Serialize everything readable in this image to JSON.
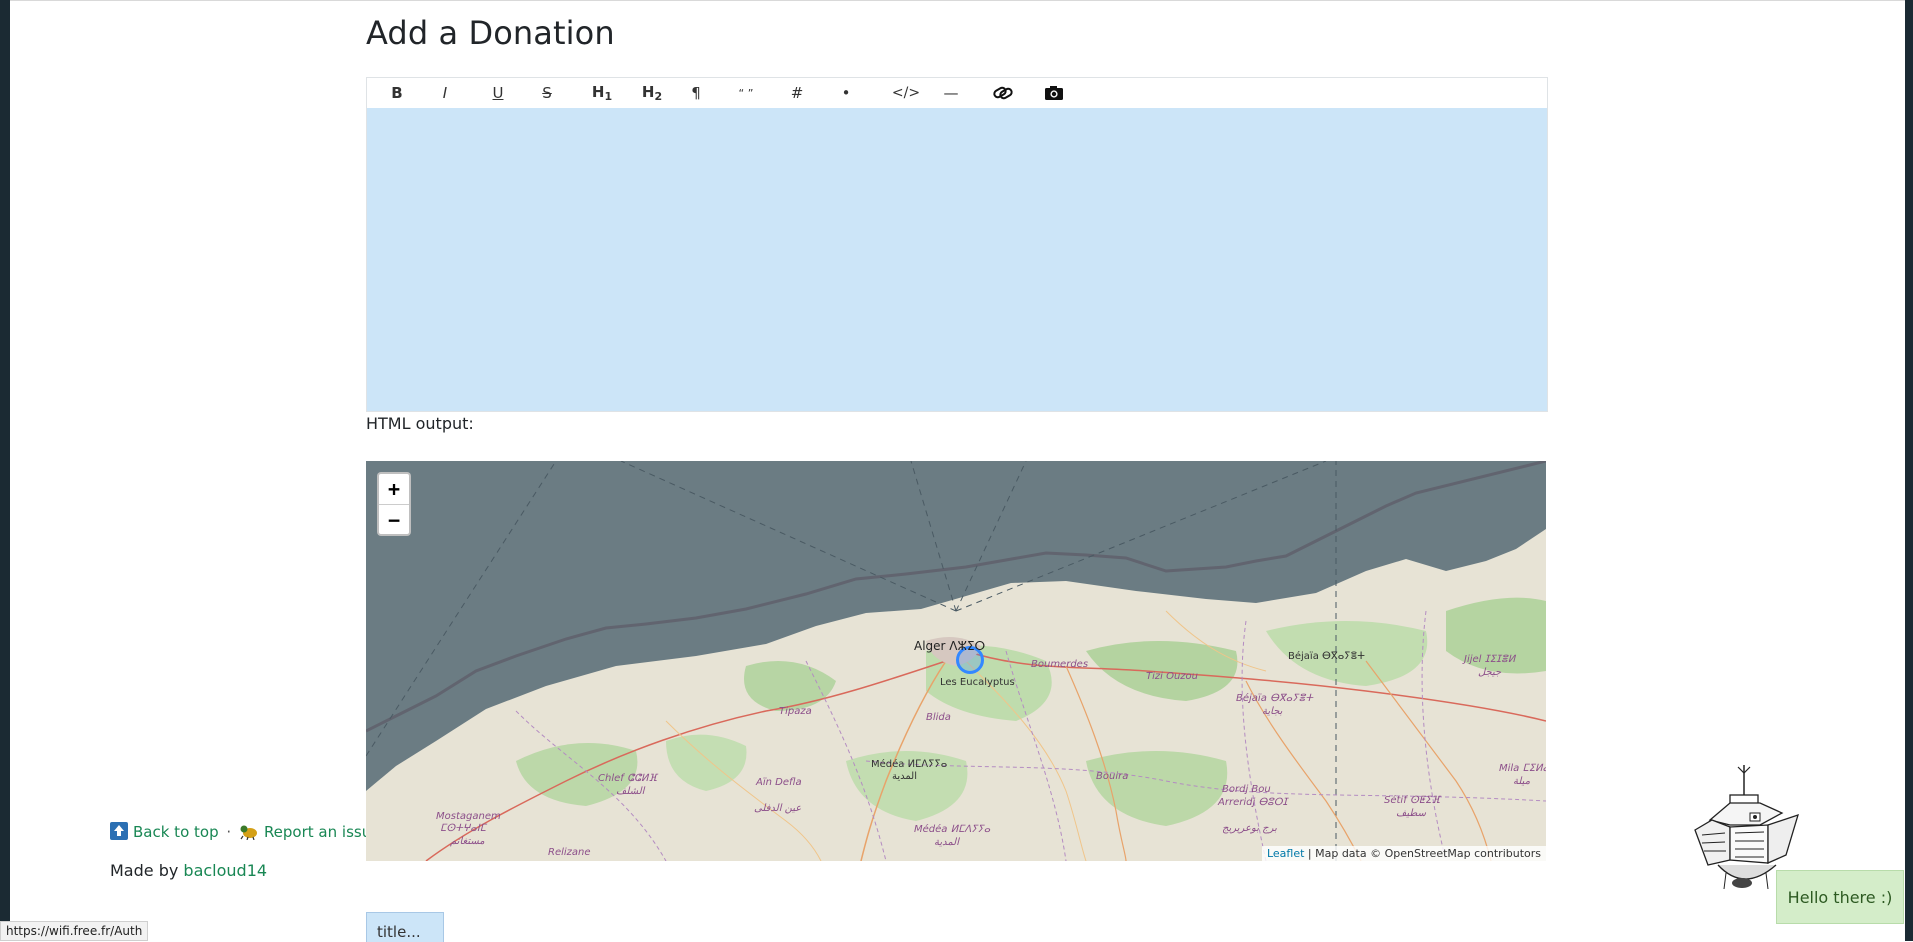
{
  "page": {
    "title": "Add a Donation"
  },
  "editor": {
    "toolbar": [
      {
        "name": "bold-button",
        "label": "B",
        "icon": "bold-icon"
      },
      {
        "name": "italic-button",
        "label": "I",
        "icon": "italic-icon"
      },
      {
        "name": "underline-button",
        "label": "U",
        "icon": "underline-icon"
      },
      {
        "name": "strikethrough-button",
        "label": "S",
        "icon": "strikethrough-icon"
      },
      {
        "name": "heading1-button",
        "label": "H",
        "sub": "1",
        "icon": "heading1-icon"
      },
      {
        "name": "heading2-button",
        "label": "H",
        "sub": "2",
        "icon": "heading2-icon"
      },
      {
        "name": "paragraph-button",
        "label": "¶",
        "icon": "paragraph-icon"
      },
      {
        "name": "quote-button",
        "label": "“ ”",
        "icon": "quote-icon"
      },
      {
        "name": "ordered-list-button",
        "label": "#",
        "icon": "ordered-list-icon"
      },
      {
        "name": "bullet-list-button",
        "label": "•",
        "icon": "bullet-list-icon"
      },
      {
        "name": "code-button",
        "label": "</>",
        "icon": "code-icon"
      },
      {
        "name": "horizontal-rule-button",
        "label": "—",
        "icon": "horizontal-rule-icon"
      },
      {
        "name": "link-button",
        "label": "",
        "icon": "link-icon"
      },
      {
        "name": "image-button",
        "label": "",
        "icon": "camera-icon"
      }
    ],
    "html_output_label": "HTML output:"
  },
  "map": {
    "zoom_in": "+",
    "zoom_out": "−",
    "labels": {
      "alger": "Alger ⴷⵣⵉⵔ",
      "les_eucalyptus": "Les Eucalyptus",
      "boumerdes": "Boumerdes",
      "tizi_ouzou": "Tizi Ouzou",
      "bejaia1": "Béjaïa ⴱⴳⴰⵢⴻⵜ",
      "bejaia2": "Béjaïa ⴱⴳⴰⵢⴻⵜ",
      "bejaia2_ar": "بجاية",
      "jijel": "Jijel ⵊⵉⵊⴻⵍ",
      "jijel_ar": "جيجل",
      "tipaza": "Tipaza",
      "blida": "Blida",
      "medea1": "Médéa ⵍⵎⴷⵢⵢⴰ",
      "medea1_ar": "المدية",
      "medea2": "Médéa ⵍⵎⴷⵢⵢⴰ",
      "medea2_ar": "المدية",
      "chlef": "Chlef ⵛⵛⵍⴼ",
      "chlef_ar": "الشلف",
      "ain_defla": "Aïn Defla",
      "ain_defla_ar": "عين الدفلى",
      "bouira": "Bouira",
      "bordj": "Bordj Bou",
      "arreridj": "Arreridj ⴱⵓⵔⵊ",
      "arreridj_ar": "برج بوعريريج",
      "setif": "Sétif ⵙⵟⵉⴼ",
      "setif_ar": "سطيف",
      "mila": "Mila ⵎⵉⵍⴰ",
      "mila_ar": "ميلة",
      "mostaganem": "Mostaganem",
      "mostaganem2": "ⵎⵙⵜⵖⴰⵏⵎ",
      "mostaganem_ar": "مستغانم",
      "relizane": "Relizane"
    },
    "attribution_leaflet": "Leaflet",
    "attribution_text": "| Map data © OpenStreetMap contributors"
  },
  "footer": {
    "back_to_top": "Back to top",
    "report_issue": "Report an issue",
    "separator": "·",
    "made_by_prefix": "Made by",
    "made_by_author": "bacloud14"
  },
  "form": {
    "title_placeholder": "title..."
  },
  "status_bar": {
    "url": "https://wifi.free.fr/Auth"
  },
  "toast": {
    "message": "Hello there :)"
  },
  "colors": {
    "editor_bg": "#cce5f8",
    "sea": "#6b7c83",
    "link_green": "#198754",
    "toast_bg": "#d4edc9",
    "rail": "#1b2a33"
  }
}
